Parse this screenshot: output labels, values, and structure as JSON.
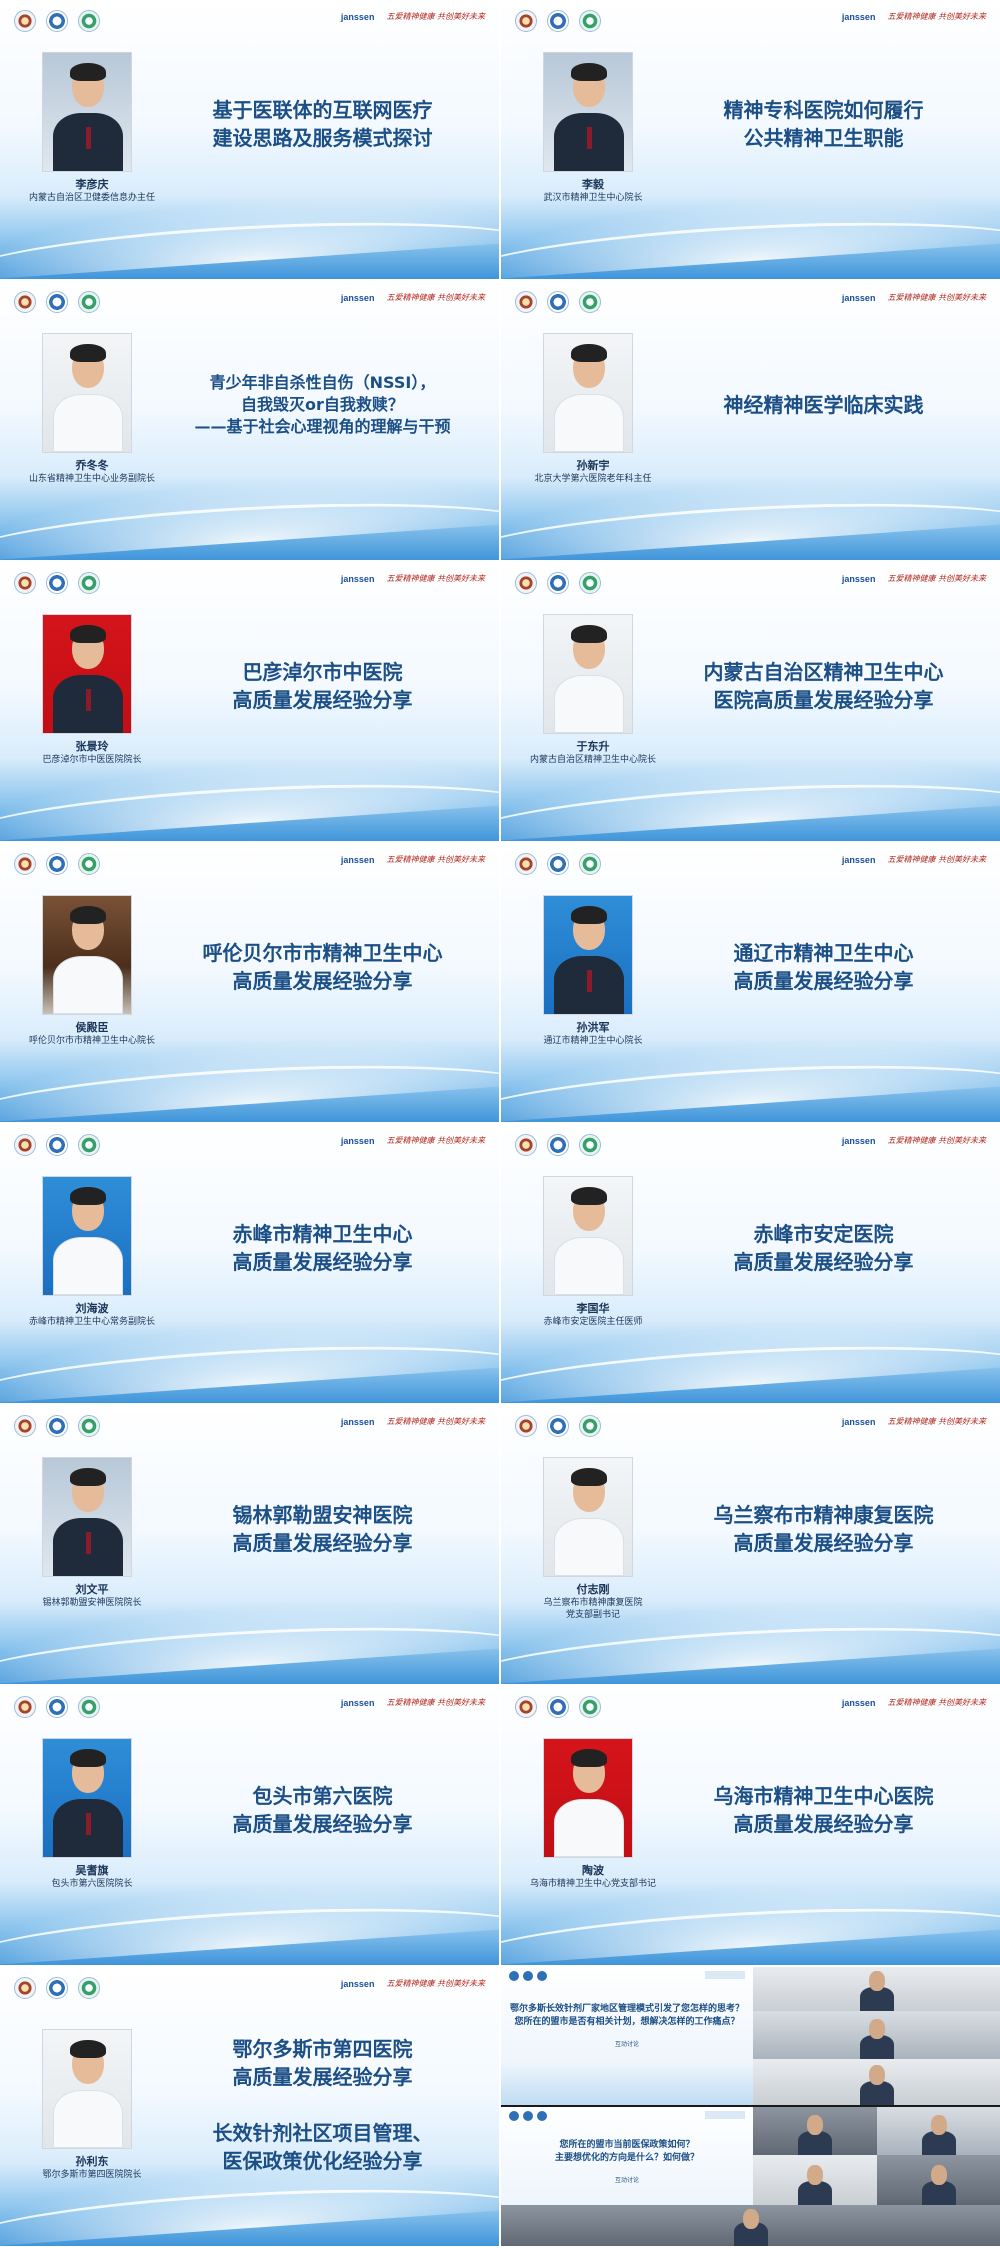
{
  "slides": [
    {
      "title": [
        "基于医联体的互联网医疗",
        "建设思路及服务模式探讨"
      ],
      "name": "李彦庆",
      "role": [
        "内蒙古自治区卫健委信息办主任"
      ]
    },
    {
      "title": [
        "精神专科医院如何履行",
        "公共精神卫生职能"
      ],
      "name": "李毅",
      "role": [
        "武汉市精神卫生中心院长"
      ]
    },
    {
      "title": [
        "青少年非自杀性自伤（NSSI），",
        "自我毁灭or自我救赎？",
        "——基于社会心理视角的理解与干预"
      ],
      "name": "乔冬冬",
      "role": [
        "山东省精神卫生中心业务副院长"
      ]
    },
    {
      "title": [
        "神经精神医学临床实践"
      ],
      "name": "孙新宇",
      "role": [
        "北京大学第六医院老年科主任"
      ]
    },
    {
      "title": [
        "巴彦淖尔市中医院",
        "高质量发展经验分享"
      ],
      "name": "张景玲",
      "role": [
        "巴彦淖尔市中医医院院长"
      ]
    },
    {
      "title": [
        "内蒙古自治区精神卫生中心",
        "医院高质量发展经验分享"
      ],
      "name": "于东升",
      "role": [
        "内蒙古自治区精神卫生中心院长"
      ]
    },
    {
      "title": [
        "呼伦贝尔市市精神卫生中心",
        "高质量发展经验分享"
      ],
      "name": "侯殿臣",
      "role": [
        "呼伦贝尔市市精神卫生中心院长"
      ]
    },
    {
      "title": [
        "通辽市精神卫生中心",
        "高质量发展经验分享"
      ],
      "name": "孙洪军",
      "role": [
        "通辽市精神卫生中心院长"
      ]
    },
    {
      "title": [
        "赤峰市精神卫生中心",
        "高质量发展经验分享"
      ],
      "name": "刘海波",
      "role": [
        "赤峰市精神卫生中心常务副院长"
      ]
    },
    {
      "title": [
        "赤峰市安定医院",
        "高质量发展经验分享"
      ],
      "name": "李国华",
      "role": [
        "赤峰市安定医院主任医师"
      ]
    },
    {
      "title": [
        "锡林郭勒盟安神医院",
        "高质量发展经验分享"
      ],
      "name": "刘文平",
      "role": [
        "锡林郭勒盟安神医院院长"
      ]
    },
    {
      "title": [
        "乌兰察布市精神康复医院",
        "高质量发展经验分享"
      ],
      "name": "付志刚",
      "role": [
        "乌兰察布市精神康复医院",
        "党支部副书记"
      ]
    },
    {
      "title": [
        "包头市第六医院",
        "高质量发展经验分享"
      ],
      "name": "吴耆旗",
      "role": [
        "包头市第六医院院长"
      ]
    },
    {
      "title": [
        "乌海市精神卫生中心医院",
        "高质量发展经验分享"
      ],
      "name": "陶波",
      "role": [
        "乌海市精神卫生中心党支部书记"
      ]
    },
    {
      "title": [
        "鄂尔多斯市第四医院",
        "高质量发展经验分享",
        "",
        "长效针剂社区项目管理、",
        "医保政策优化经验分享"
      ],
      "name": "孙利东",
      "role": [
        "鄂尔多斯市第四医院院长"
      ]
    }
  ],
  "brand": {
    "janssen": "janssen",
    "motto_line1": "五爱精神健康",
    "motto_line2": "共创美好未来"
  },
  "conference": {
    "q1": [
      "鄂尔多斯长效针剂厂家地区管理模式引发了您怎样的思考？",
      "您所在的盟市是否有相关计划，想解决怎样的工作痛点？"
    ],
    "q2": [
      "您所在的盟市当前医保政策如何？",
      "主要想优化的方向是什么？如何做？"
    ],
    "sig": "互动讨论"
  }
}
